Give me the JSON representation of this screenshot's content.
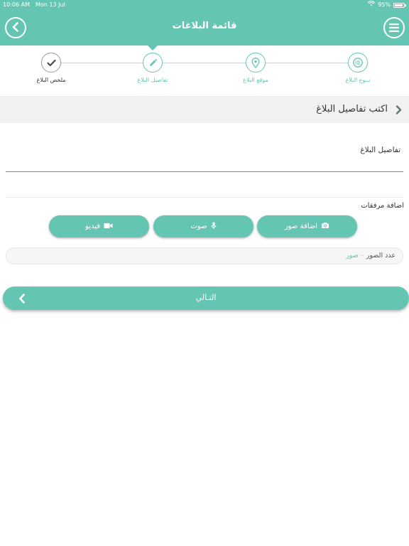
{
  "status_bar": {
    "time": "10:06 AM",
    "date": "Mon 13 Jul",
    "battery": "95%"
  },
  "header": {
    "title": "قائمة البلاغات",
    "back_icon": "chevron-left-icon",
    "menu_icon": "hamburger-menu-icon"
  },
  "stepper": {
    "steps": [
      {
        "label": "نــوع البلاغ",
        "icon": "list-icon",
        "state": "active"
      },
      {
        "label": "موقع البلاغ",
        "icon": "location-pin-icon",
        "state": "active"
      },
      {
        "label": "تفاصيل البلاغ",
        "icon": "pencil-icon",
        "state": "current"
      },
      {
        "label": "ملخص البلاغ",
        "icon": "check-icon",
        "state": "done"
      }
    ]
  },
  "section": {
    "title": "اكتب تفاصيل البلاغ"
  },
  "details": {
    "label": "تفاصيل البلاغ",
    "value": ""
  },
  "attachments": {
    "label": "اضافة مرفقات",
    "buttons": [
      {
        "label": "اضافة صور",
        "icon": "camera-icon"
      },
      {
        "label": "صوت",
        "icon": "microphone-icon"
      },
      {
        "label": "فيديو",
        "icon": "video-camera-icon"
      }
    ],
    "count_label": "عدد الصور",
    "count_value": "٠",
    "count_unit": "صور"
  },
  "next_button": {
    "label": "التـالي"
  },
  "colors": {
    "accent": "#65c5b3",
    "section_bg": "#f1f1f1",
    "text": "#333333"
  }
}
